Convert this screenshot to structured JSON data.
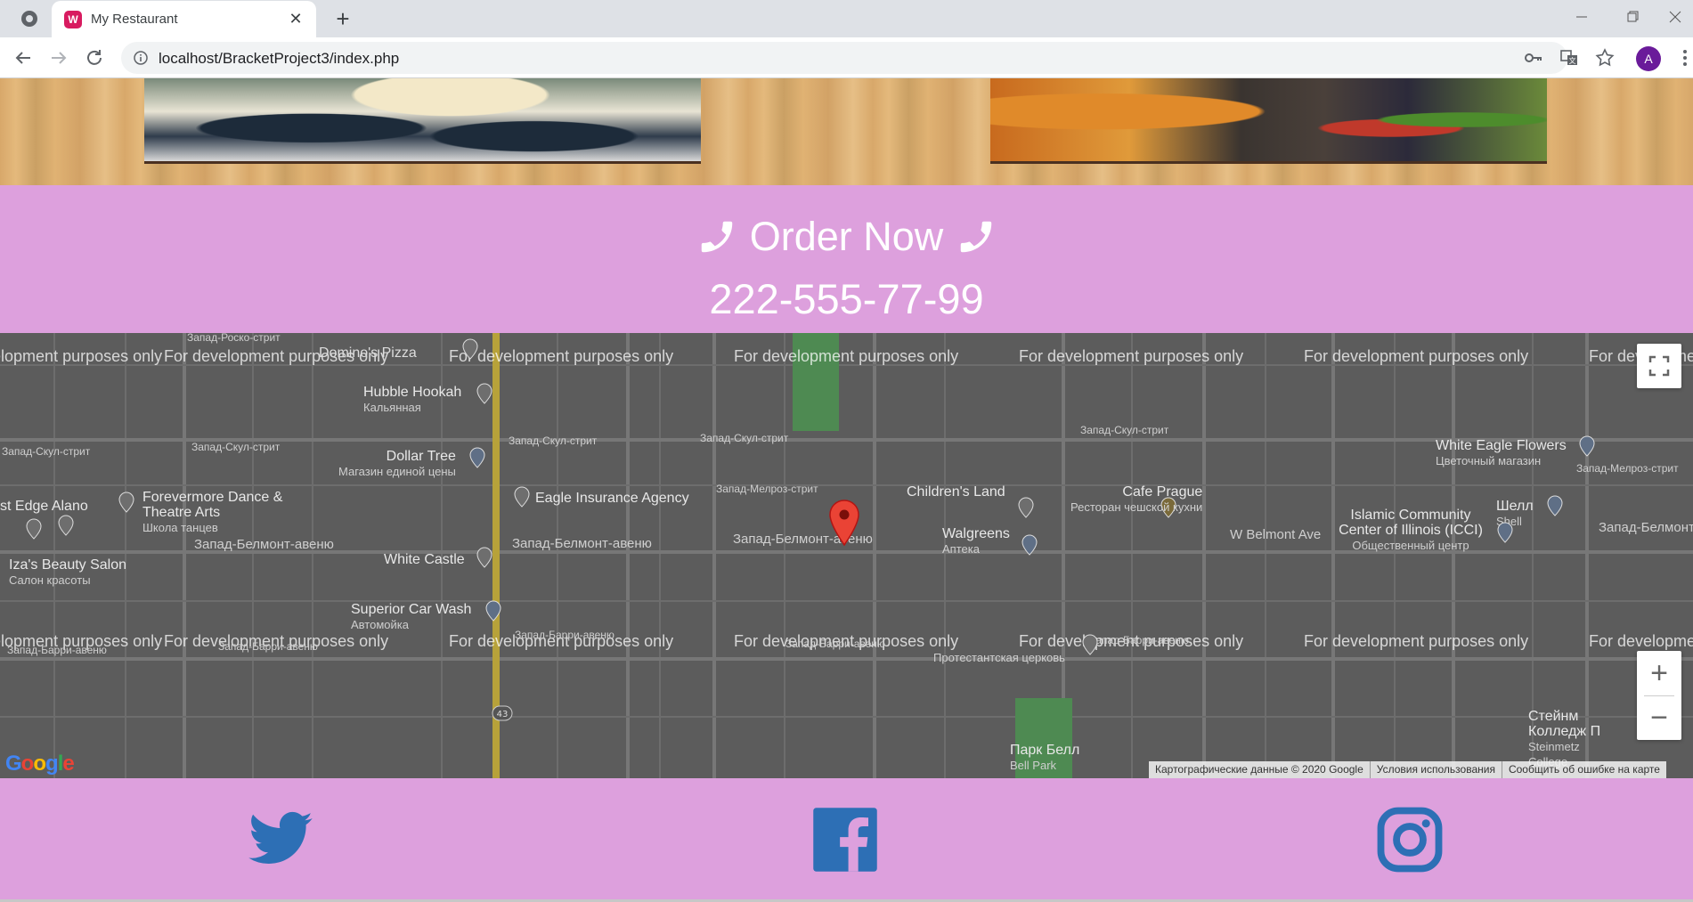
{
  "browser": {
    "tab_title": "My Restaurant",
    "favicon_letter": "W",
    "url": "localhost/BracketProject3/index.php",
    "avatar_letter": "A"
  },
  "order": {
    "heading": "Order Now",
    "phone": "222-555-77-99"
  },
  "map": {
    "watermark": "For development purposes only",
    "streets": [
      "Запад-Роско-стрит",
      "Запад-Скул-стрит",
      "Запад-Скул-стрит",
      "Запад-Скул-стрит",
      "Запад-Скул-стрит",
      "Запад-Мелроз-стрит",
      "Запад-Белмонт-авеню",
      "Запад-Белмонт-авеню",
      "Запад-Белмонт-авеню",
      "Запад-Барри-авеню",
      "Запад-Барри-авеню",
      "Запад-Барри-авеню",
      "Запад-Барри-авеню",
      "Запад-Скул-стрит",
      "Запад-Мелроз-стрит",
      "Запад-Белмонт",
      "Запад-Барри-авеню",
      "W Belmont Ave"
    ],
    "places": [
      {
        "name": "Domino's Pizza",
        "sub": ""
      },
      {
        "name": "Hubble Hookah",
        "sub": "Кальянная"
      },
      {
        "name": "Dollar Tree",
        "sub": "Магазин единой цены"
      },
      {
        "name": "Eagle Insurance Agency",
        "sub": ""
      },
      {
        "name": "Forevermore Dance & Theatre Arts",
        "sub": "Школа танцев"
      },
      {
        "name": "st Edge Alano",
        "sub": ""
      },
      {
        "name": "Iza's Beauty Salon",
        "sub": "Салон красоты"
      },
      {
        "name": "White Castle",
        "sub": ""
      },
      {
        "name": "Superior Car Wash",
        "sub": "Автомойка"
      },
      {
        "name": "Children's Land",
        "sub": ""
      },
      {
        "name": "Walgreens",
        "sub": "Аптека"
      },
      {
        "name": "Cafe Prague",
        "sub": "Ресторан чешской кухни"
      },
      {
        "name": "White Eagle Flowers",
        "sub": "Цветочный магазин"
      },
      {
        "name": "Шелл",
        "sub": "Shell"
      },
      {
        "name": "Islamic Community Center of Illinois (ICCI)",
        "sub": "Общественный центр"
      },
      {
        "name": "Протестантская церковь",
        "sub": ""
      },
      {
        "name": "Парк Белл",
        "sub": "Bell Park"
      },
      {
        "name": "Стейнм Колледж П",
        "sub": "Steinmetz College"
      }
    ],
    "route_number": "43",
    "logo": "Google",
    "attribution": [
      "Картографические данные © 2020 Google",
      "Условия использования",
      "Сообщить об ошибке на карте"
    ]
  },
  "social": {
    "icons": [
      "twitter-icon",
      "facebook-icon",
      "instagram-icon"
    ],
    "color": "#2d6fb5"
  },
  "colors": {
    "band": "#dda0dd",
    "map_bg": "#5c5c5c"
  }
}
